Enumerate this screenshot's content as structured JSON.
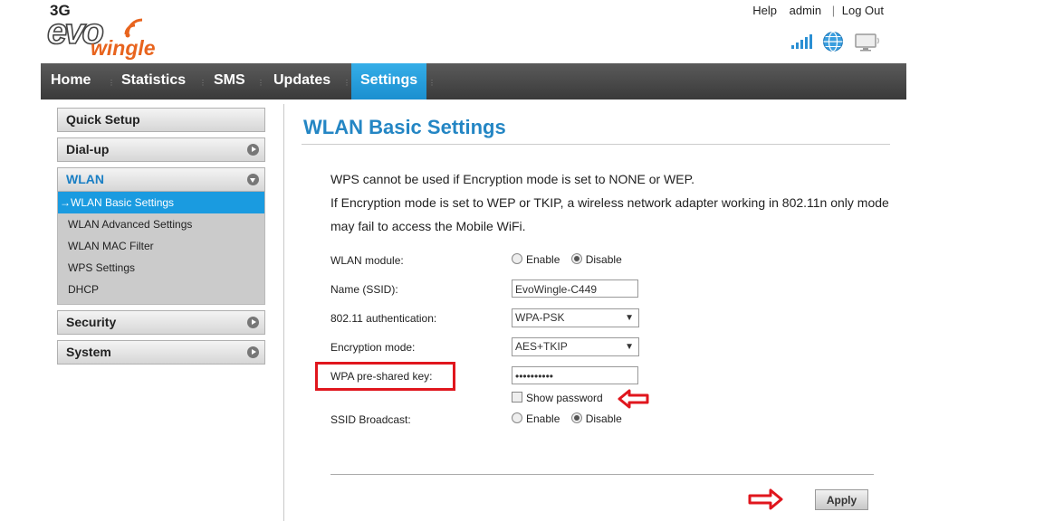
{
  "header": {
    "logo": {
      "prefix": "3G",
      "brand": "evo",
      "product": "wingle"
    },
    "links": {
      "help": "Help",
      "user": "admin",
      "logout": "Log Out"
    }
  },
  "nav": {
    "home": "Home",
    "statistics": "Statistics",
    "sms": "SMS",
    "updates": "Updates",
    "settings": "Settings"
  },
  "sidebar": {
    "quick_setup": "Quick Setup",
    "dialup": "Dial-up",
    "wlan": "WLAN",
    "wlan_items": {
      "basic": "→WLAN Basic Settings",
      "advanced": "WLAN Advanced Settings",
      "mac": "WLAN MAC Filter",
      "wps": "WPS Settings",
      "dhcp": "DHCP"
    },
    "security": "Security",
    "system": "System"
  },
  "main": {
    "title": "WLAN Basic Settings",
    "note1": "WPS cannot be used if Encryption mode is set to NONE or WEP.",
    "note2": "If Encryption mode is set to WEP or TKIP, a wireless network adapter working in 802.11n only mode may fail to access the Mobile WiFi.",
    "wlan_module": {
      "label": "WLAN module:",
      "enable": "Enable",
      "disable": "Disable",
      "selected": "Disable"
    },
    "ssid": {
      "label": "Name (SSID):",
      "value": "EvoWingle-C449"
    },
    "auth": {
      "label": "802.11 authentication:",
      "value": "WPA-PSK"
    },
    "encryption": {
      "label": "Encryption mode:",
      "value": "AES+TKIP"
    },
    "psk": {
      "label": "WPA pre-shared key:",
      "value": "••••••••••"
    },
    "show_password": "Show password",
    "ssid_broadcast": {
      "label": "SSID Broadcast:",
      "enable": "Enable",
      "disable": "Disable",
      "selected": "Disable"
    },
    "apply": "Apply"
  },
  "colors": {
    "accent": "#1a9be0",
    "title": "#2486c4",
    "annotation": "#e0161d",
    "brand_orange": "#e8641e"
  }
}
